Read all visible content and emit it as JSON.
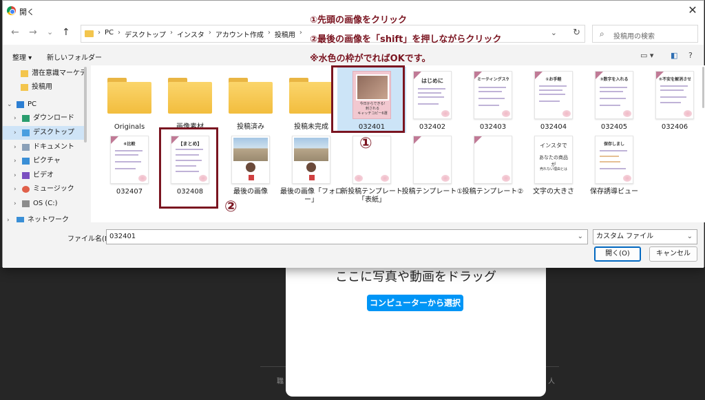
{
  "background_app": {
    "drop_text": "ここに写真や動画をドラッグ",
    "select_button": "コンピューターから選択",
    "frag_left": "職",
    "frag_right": "人"
  },
  "dialog": {
    "title": "開く",
    "close": "✕",
    "nav": {
      "back": "←",
      "forward": "→",
      "recent": "⌄",
      "up": "↑"
    },
    "breadcrumbs": [
      "PC",
      "デスクトップ",
      "インスタ",
      "アカウント作成",
      "投稿用"
    ],
    "breadcrumb_sep": "›",
    "address_dropdown": "⌄",
    "refresh": "↻",
    "search_placeholder": "投稿用の検索",
    "search_icon": "⌕",
    "toolbar": {
      "organize": "整理 ▾",
      "new_folder": "新しいフォルダー",
      "view_icon": "▭ ▾",
      "pane_icon": "◧",
      "help_icon": "?"
    },
    "nav_pane": [
      {
        "label": "潜在意識マーケティ",
        "icon": "folder",
        "chev": ""
      },
      {
        "label": "投稿用",
        "icon": "folder",
        "chev": ""
      },
      {
        "label": "PC",
        "icon": "pc",
        "chev": "⌄"
      },
      {
        "label": "ダウンロード",
        "icon": "download",
        "chev": "›"
      },
      {
        "label": "デスクトップ",
        "icon": "desktop",
        "chev": "›",
        "selected": true
      },
      {
        "label": "ドキュメント",
        "icon": "document",
        "chev": "›"
      },
      {
        "label": "ピクチャ",
        "icon": "picture",
        "chev": "›"
      },
      {
        "label": "ビデオ",
        "icon": "video",
        "chev": "›"
      },
      {
        "label": "ミュージック",
        "icon": "music",
        "chev": "›"
      },
      {
        "label": "OS (C:)",
        "icon": "drive",
        "chev": "›"
      },
      {
        "label": "ネットワーク",
        "icon": "network",
        "chev": "›"
      }
    ],
    "files_row1": [
      {
        "name": "Originals",
        "kind": "folder"
      },
      {
        "name": "画像素材",
        "kind": "folder"
      },
      {
        "name": "投稿済み",
        "kind": "folder"
      },
      {
        "name": "投稿未完成",
        "kind": "folder"
      },
      {
        "name": "032401",
        "kind": "selected"
      },
      {
        "name": "032402",
        "kind": "doc",
        "title": "はじめに"
      },
      {
        "name": "032403",
        "kind": "doc",
        "title": "ミーティングスケール"
      },
      {
        "name": "032404",
        "kind": "doc",
        "title": "①お手軽"
      },
      {
        "name": "032405",
        "kind": "doc",
        "title": "③数字を入れる"
      },
      {
        "name": "032406",
        "kind": "doc",
        "title": "⑤不安を解消させる"
      }
    ],
    "files_row2": [
      {
        "name": "032407",
        "kind": "doc",
        "title": "⑥比較"
      },
      {
        "name": "032408",
        "kind": "doc",
        "title": "【まとめ】"
      },
      {
        "name": "最後の画像",
        "kind": "photo"
      },
      {
        "name": "最後の画像「フォロー」",
        "kind": "photo"
      },
      {
        "name": "新投稿テンプレート「表紙」",
        "kind": "blank"
      },
      {
        "name": "投稿テンプレート①",
        "kind": "blank"
      },
      {
        "name": "投稿テンプレート②",
        "kind": "blank"
      },
      {
        "name": "文字の大きさ",
        "kind": "text",
        "line1": "インスタで",
        "line2": "あなたの商品が",
        "line3": "売れない理由とは"
      },
      {
        "name": "保存誘導ビュー",
        "kind": "doc",
        "title": "保存しまし"
      }
    ],
    "selected_thumb_caption": "今日からできる!\n刺される\nキャッチコピー6選",
    "filename_label": "ファイル名(N):",
    "filename_value": "032401",
    "dropdown_arrow": "⌄",
    "file_type": "カスタム ファイル",
    "open_button": "開く(O)",
    "cancel_button": "キャンセル"
  },
  "annotations": {
    "step1": "①先頭の画像をクリック",
    "step2": "②最後の画像を「shift」を押しながらクリック",
    "step3": "※水色の枠がでればOKです。",
    "marker1": "①",
    "marker2": "②"
  }
}
